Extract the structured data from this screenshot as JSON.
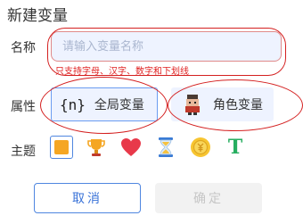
{
  "dialog": {
    "title": "新建变量"
  },
  "name_field": {
    "label": "名称",
    "placeholder": "请输入变量名称",
    "value": "",
    "hint": "只支持字母、汉字、数字和下划线"
  },
  "attribute": {
    "label": "属性",
    "options": [
      {
        "icon_text": "{n}",
        "label": "全局变量",
        "selected": true
      },
      {
        "icon": "character-icon",
        "label": "角色变量",
        "selected": false
      }
    ]
  },
  "theme": {
    "label": "主题",
    "options": [
      {
        "icon": "orange-square-icon",
        "selected": true
      },
      {
        "icon": "trophy-icon"
      },
      {
        "icon": "heart-icon"
      },
      {
        "icon": "hourglass-icon"
      },
      {
        "icon": "coin-icon"
      },
      {
        "icon": "letter-t-icon",
        "text": "T"
      }
    ]
  },
  "buttons": {
    "cancel": "取消",
    "confirm": "确定"
  },
  "colors": {
    "accent": "#3a73d8",
    "hint": "#e02020",
    "annotation": "#d42020"
  }
}
